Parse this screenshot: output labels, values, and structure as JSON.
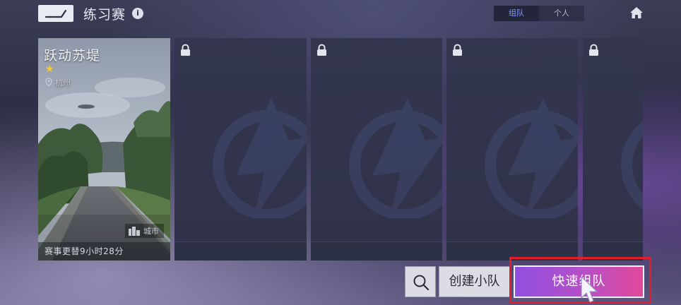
{
  "header": {
    "title": "练习赛",
    "info_glyph": "i",
    "mode_tabs": [
      {
        "label": "组队",
        "active": true
      },
      {
        "label": "个人",
        "active": false
      }
    ],
    "back_icon": "back-arrow-icon",
    "home_icon": "home-icon"
  },
  "map_card": {
    "name": "跃动苏堤",
    "stars": "★",
    "city": "杭州",
    "badge_label": "城市",
    "timer": "赛事更替9小时28分"
  },
  "locked_cards": [
    {
      "locked": true
    },
    {
      "locked": true
    },
    {
      "locked": true
    },
    {
      "locked": true
    }
  ],
  "actions": {
    "search_icon": "search-icon",
    "create_team_label": "创建小队",
    "quick_match_label": "快速组队"
  },
  "colors": {
    "accent_blue": "#7f9cff",
    "star_yellow": "#f5c935",
    "button_gradient_start": "#8f4fe0",
    "button_gradient_end": "#e0489a",
    "highlight_red": "#e21d2b"
  }
}
